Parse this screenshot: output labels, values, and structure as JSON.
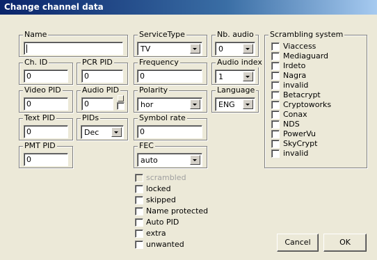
{
  "window": {
    "title": "Change channel data"
  },
  "fields": {
    "name": {
      "label": "Name",
      "value": ""
    },
    "ch_id": {
      "label": "Ch. ID",
      "value": "0"
    },
    "pcr_pid": {
      "label": "PCR PID",
      "value": "0"
    },
    "video_pid": {
      "label": "Video PID",
      "value": "0"
    },
    "audio_pid": {
      "label": "Audio PID",
      "value": "0"
    },
    "text_pid": {
      "label": "Text PID",
      "value": "0"
    },
    "pids": {
      "label": "PIDs",
      "value": "Dec"
    },
    "pmt_pid": {
      "label": "PMT PID",
      "value": "0"
    },
    "service_type": {
      "label": "ServiceType",
      "value": "TV"
    },
    "nb_audio": {
      "label": "Nb. audio",
      "value": "0"
    },
    "frequency": {
      "label": "Frequency",
      "value": "0"
    },
    "audio_index": {
      "label": "Audio index",
      "value": "1"
    },
    "polarity": {
      "label": "Polarity",
      "value": "hor"
    },
    "language": {
      "label": "Language",
      "value": "ENG"
    },
    "symbol_rate": {
      "label": "Symbol rate",
      "value": "0"
    },
    "fec": {
      "label": "FEC",
      "value": "auto"
    }
  },
  "flags": [
    {
      "label": "scrambled",
      "checked": false,
      "disabled": true
    },
    {
      "label": "locked",
      "checked": false,
      "disabled": false
    },
    {
      "label": "skipped",
      "checked": false,
      "disabled": false
    },
    {
      "label": "Name protected",
      "checked": false,
      "disabled": false
    },
    {
      "label": "Auto PID",
      "checked": false,
      "disabled": false
    },
    {
      "label": "extra",
      "checked": false,
      "disabled": false
    },
    {
      "label": "unwanted",
      "checked": false,
      "disabled": false
    }
  ],
  "scrambling": {
    "title": "Scrambling system",
    "items": [
      {
        "label": "Viaccess",
        "checked": false
      },
      {
        "label": "Mediaguard",
        "checked": false
      },
      {
        "label": "Irdeto",
        "checked": false
      },
      {
        "label": "Nagra",
        "checked": false
      },
      {
        "label": "invalid",
        "checked": false
      },
      {
        "label": "Betacrypt",
        "checked": false
      },
      {
        "label": "Cryptoworks",
        "checked": false
      },
      {
        "label": "Conax",
        "checked": false
      },
      {
        "label": "NDS",
        "checked": false
      },
      {
        "label": "PowerVu",
        "checked": false
      },
      {
        "label": "SkyCrypt",
        "checked": false
      },
      {
        "label": "invalid",
        "checked": false
      }
    ]
  },
  "buttons": {
    "cancel": "Cancel",
    "ok": "OK"
  }
}
